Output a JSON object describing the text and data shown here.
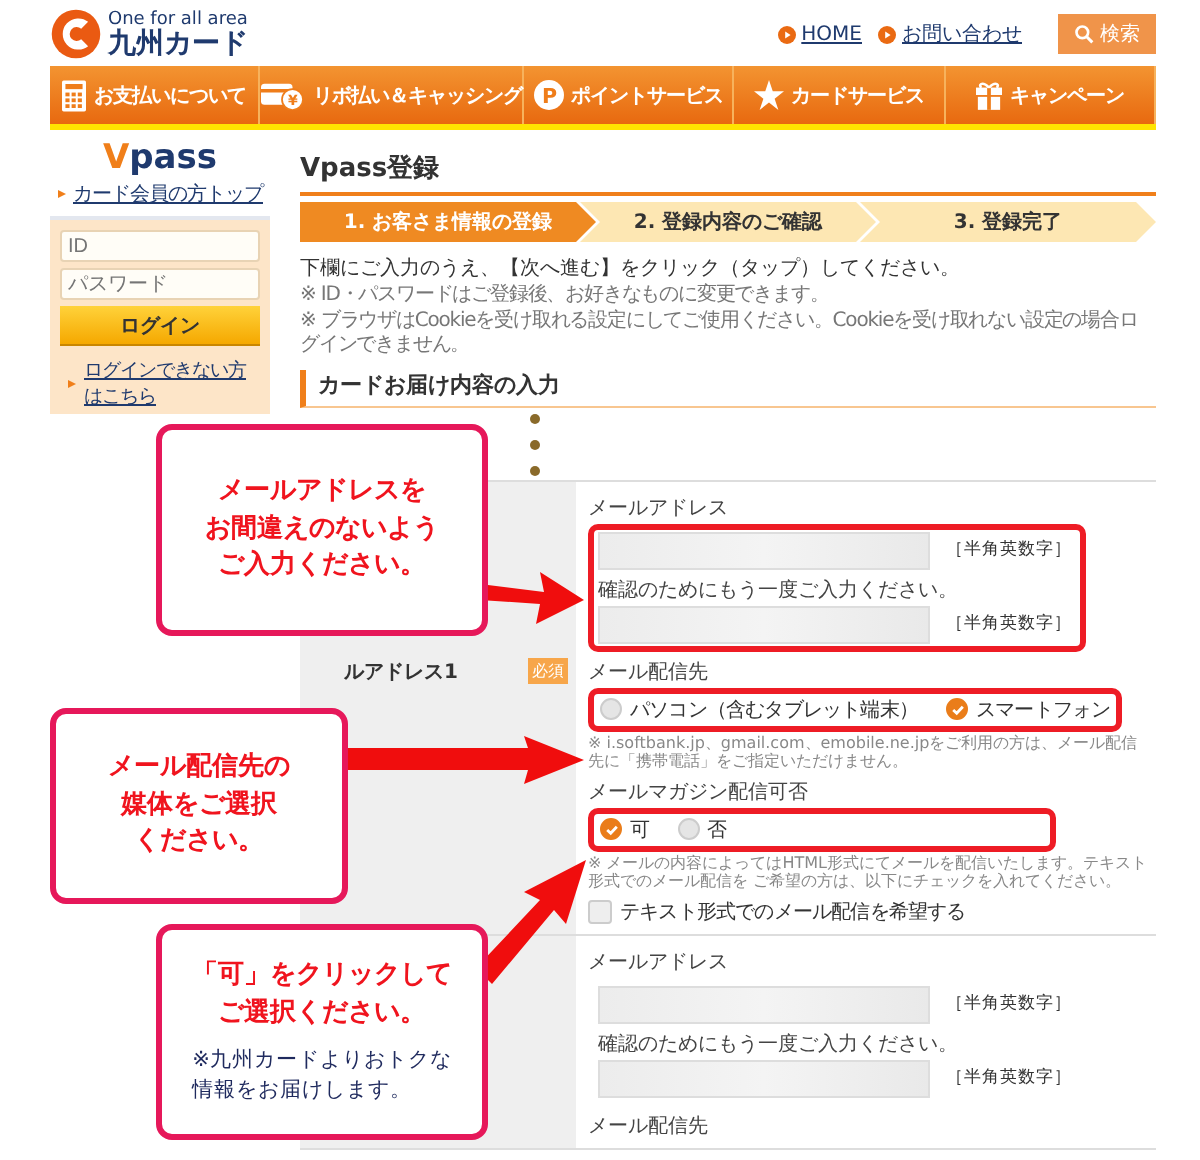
{
  "header": {
    "logo_tagline": "One for all area",
    "logo_name": "九州カード",
    "links": [
      "HOME",
      "お問い合わせ"
    ],
    "search_button": "検索"
  },
  "nav": [
    {
      "label": "お支払いについて",
      "kind": "calculator"
    },
    {
      "label": "リボ払い＆キャッシング",
      "kind": "card",
      "icon_text": "¥"
    },
    {
      "label": "ポイントサービス",
      "kind": "point",
      "icon_text": "P"
    },
    {
      "label": "カードサービス",
      "kind": "star"
    },
    {
      "label": "キャンペーン",
      "kind": "gift"
    }
  ],
  "sidebar": {
    "logo": "Vpass",
    "top_link": "カード会員の方トップ",
    "id_placeholder": "ID",
    "password_placeholder": "パスワード",
    "login_button": "ログイン",
    "links": [
      "ログインできない方はこちら"
    ]
  },
  "main": {
    "title": "Vpass登録",
    "steps": [
      {
        "label": "1. お客さま情報の登録",
        "selected": true
      },
      {
        "label": "2. 登録内容のご確認",
        "selected": false
      },
      {
        "label": "3. 登録完了",
        "selected": false
      }
    ],
    "instruction": "下欄にご入力のうえ、【次へ進む】をクリック（タップ）してください。",
    "notes": [
      "※ ID・パスワードはご登録後、お好きなものに変更できます。",
      "※ ブラウザはCookieを受け取れる設定にしてご使用ください。Cookieを受け取れない設定の場合ログインできません。"
    ],
    "section_heading": "カードお届け内容の入力"
  },
  "form": {
    "sections": [
      {
        "label": "ルアドレス1",
        "required": "必須",
        "items": [
          {
            "kind": "email_pair",
            "label": "メールアドレス",
            "confirm_label": "確認のためにもう一度ご入力ください。",
            "hint": "［半角英数字］",
            "confirm_hint": "［半角英数字］",
            "highlighted": true
          },
          {
            "kind": "radio",
            "label": "メール配信先",
            "options": [
              {
                "label": "パソコン（含むタブレット端末）",
                "selected": false
              },
              {
                "label": "スマートフォン",
                "selected": true
              }
            ],
            "note": "※ i.softbank.jp、gmail.com、emobile.ne.jpをご利用の方は、メール配信先に「携帯電話」をご指定いただけません。",
            "highlighted": true
          },
          {
            "kind": "radio",
            "label": "メールマガジン配信可否",
            "options": [
              {
                "label": "可",
                "selected": true
              },
              {
                "label": "否",
                "selected": false
              }
            ],
            "note": "※ メールの内容によってはHTML形式にてメールを配信いたします。テキスト形式でのメール配信を ご希望の方は、以下にチェックを入れてください。",
            "highlighted": true
          },
          {
            "kind": "checkbox",
            "label": "テキスト形式でのメール配信を希望する",
            "checked": false
          }
        ]
      },
      {
        "items": [
          {
            "kind": "email_pair",
            "label": "メールアドレス",
            "confirm_label": "確認のためにもう一度ご入力ください。",
            "hint": "［半角英数字］",
            "confirm_hint": "［半角英数字］",
            "highlighted": false
          },
          {
            "kind": "heading",
            "label": "メール配信先"
          }
        ]
      }
    ]
  },
  "callouts": [
    {
      "lines": [
        "メールアドレスを",
        "お間違えのないよう",
        "ご入力ください。"
      ]
    },
    {
      "lines": [
        "メール配信先の",
        "媒体をご選択",
        "ください。"
      ]
    },
    {
      "lines": [
        "「可」をクリックして",
        "ご選択ください。"
      ],
      "note_lines": [
        "※九州カードよりおトクな",
        "情報をお届けします。"
      ]
    }
  ]
}
